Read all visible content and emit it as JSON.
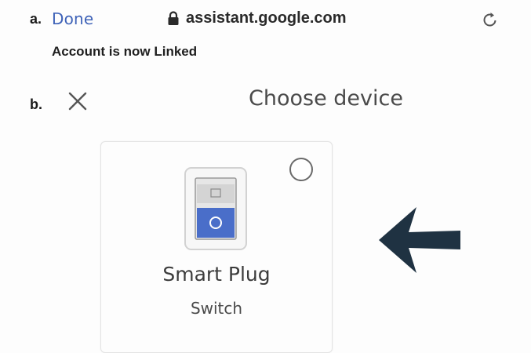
{
  "step_a": {
    "marker": "a.",
    "done_label": "Done",
    "url": "assistant.google.com",
    "status": "Account is now Linked"
  },
  "step_b": {
    "marker": "b.",
    "title": "Choose device"
  },
  "device": {
    "name": "Smart Plug",
    "type": "Switch",
    "selected": false
  },
  "icons": {
    "lock": "lock-icon",
    "reload": "reload-icon",
    "close": "close-icon",
    "radio": "radio-unselected-icon",
    "device": "smart-plug-switch-icon",
    "pointer": "left-arrow-icon"
  },
  "colors": {
    "link_blue": "#3f63b8",
    "device_blue": "#4a6ec9",
    "arrow_dark": "#1f3242"
  }
}
